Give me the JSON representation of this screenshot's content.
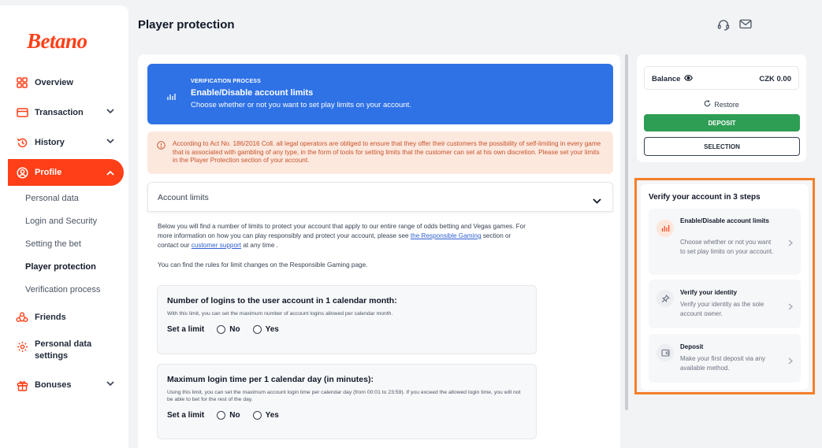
{
  "brand": {
    "logo": "Betano",
    "accent": "#ff3f17"
  },
  "sidebar": {
    "items": [
      {
        "label": "Overview",
        "icon": "grid-icon"
      },
      {
        "label": "Transaction",
        "icon": "card-icon"
      },
      {
        "label": "History",
        "icon": "history-icon"
      },
      {
        "label": "Profile",
        "icon": "user-icon"
      },
      {
        "label": "Friends",
        "icon": "friends-icon"
      },
      {
        "label": "Personal data settings",
        "icon": "gear-icon"
      },
      {
        "label": "Bonuses",
        "icon": "gift-icon"
      }
    ],
    "subitems": [
      {
        "label": "Personal data"
      },
      {
        "label": "Login and Security"
      },
      {
        "label": "Setting the bet"
      },
      {
        "label": "Player protection"
      },
      {
        "label": "Verification process"
      }
    ]
  },
  "header": {
    "title": "Player protection"
  },
  "banner": {
    "kicker": "VERIFICATION PROCESS",
    "title": "Enable/Disable account limits",
    "subtitle": "Choose whether or not you want to set play limits on your account.",
    "color": "#2f72e6"
  },
  "warning": {
    "text": "According to Act No. 186/2016 Coll. all legal operators are obliged to ensure that they offer their customers the possibility of self-limiting in every game that is associated with gambling of any type, in the form of tools for setting limits that the customer can set at his own discretion. Please set your limits in the Player Protection section of your account."
  },
  "accordion": {
    "title": "Account limits"
  },
  "intro": {
    "part1": "Below you will find a number of limits to protect your account that apply to our entire range of odds betting and Vegas games. For more information on how you can play responsibly and protect your account, please see ",
    "link1": "the Responsible Gaming",
    "part2": " section or contact our ",
    "link2": "customer support",
    "part3": " at any time .",
    "rules": "You can find the rules for limit changes on the Responsible Gaming page."
  },
  "limits": [
    {
      "title": "Number of logins to the user account in 1 calendar month:",
      "desc": "With this limit, you can set the maximum number of account logins allowed per calendar month.",
      "set_label": "Set a limit",
      "no": "No",
      "yes": "Yes"
    },
    {
      "title": "Maximum login time per 1 calendar day (in minutes):",
      "desc": "Using this limit, you can set the maximum account login time per calendar day (from 00:01 to 23:59). If you exceed the allowed login time, you will not be able to bet for the rest of the day.",
      "set_label": "Set a limit",
      "no": "No",
      "yes": "Yes"
    }
  ],
  "balance": {
    "label": "Balance",
    "value": "CZK 0.00",
    "restore": "Restore",
    "deposit": "DEPOSIT",
    "selection": "SELECTION",
    "deposit_color": "#2f9e55"
  },
  "verify": {
    "title": "Verify your account in 3 steps",
    "highlight_color": "#f57f2a",
    "steps": [
      {
        "title": "Enable/Disable account limits",
        "desc": "Choose whether or not you want to set play limits on your account.",
        "icon": "bar-chart-icon"
      },
      {
        "title": "Verify your identity",
        "desc": "Verify your identity as the sole account owner.",
        "icon": "pin-icon"
      },
      {
        "title": "Deposit",
        "desc": "Make your first deposit via any available method.",
        "icon": "wallet-icon"
      }
    ]
  }
}
